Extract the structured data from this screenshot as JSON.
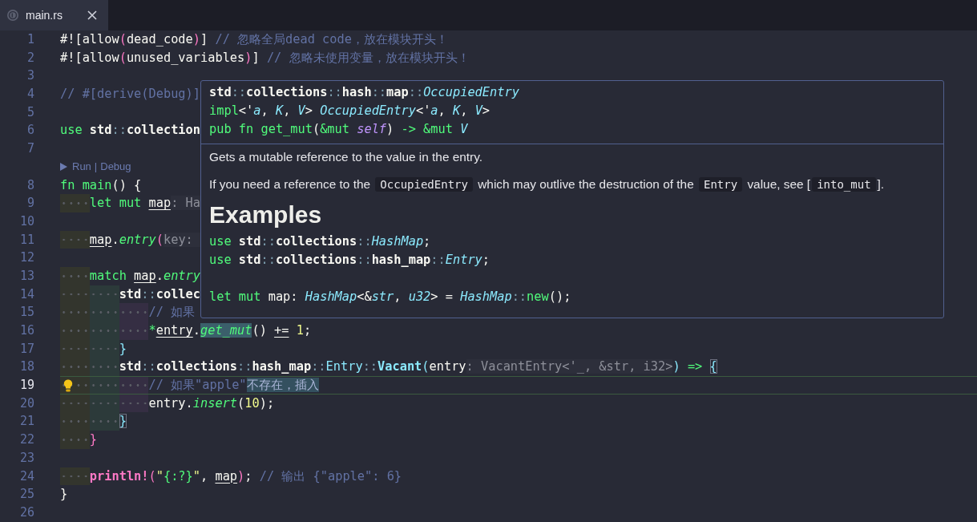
{
  "tab": {
    "label": "main.rs",
    "selected": true
  },
  "lines": [
    {
      "kind": "code",
      "number": "1",
      "current": false,
      "tokens": [
        {
          "text": "#![allow",
          "kind": "p"
        },
        {
          "text": "(",
          "kind": "paren"
        },
        {
          "text": "dead_code",
          "kind": "p"
        },
        {
          "text": ")",
          "kind": "paren"
        },
        {
          "text": "]",
          "kind": "p"
        },
        {
          "text": " // 忽略全局dead code，放在模块开头！",
          "kind": "cm"
        }
      ]
    },
    {
      "kind": "code",
      "number": "2",
      "current": false,
      "tokens": [
        {
          "text": "#![allow",
          "kind": "p"
        },
        {
          "text": "(",
          "kind": "paren"
        },
        {
          "text": "unused_variables",
          "kind": "p"
        },
        {
          "text": ")",
          "kind": "paren"
        },
        {
          "text": "]",
          "kind": "p"
        },
        {
          "text": " // 忽略未使用变量，放在模块开头！",
          "kind": "cm"
        }
      ]
    },
    {
      "kind": "code",
      "number": "3",
      "current": false
    },
    {
      "kind": "code",
      "number": "4",
      "current": false,
      "tokens": [
        {
          "text": "// #[derive(Debug)]",
          "kind": "cm"
        }
      ]
    },
    {
      "kind": "code",
      "number": "5",
      "current": false
    },
    {
      "kind": "code",
      "number": "6",
      "current": false,
      "tokens": [
        {
          "text": "use ",
          "kind": "kw"
        },
        {
          "text": "std",
          "kind": "path"
        },
        {
          "text": "::",
          "kind": "sep"
        },
        {
          "text": "collection",
          "kind": "path"
        }
      ]
    },
    {
      "kind": "code",
      "number": "7",
      "current": false
    },
    {
      "kind": "codelens",
      "run": "Run",
      "separator": "|",
      "debug": "Debug"
    },
    {
      "kind": "code",
      "number": "8",
      "current": false,
      "tokens": [
        {
          "text": "fn main",
          "kind": "kw"
        },
        {
          "text": "() {",
          "kind": "p"
        }
      ],
      "children": [
        {
          "kind": "code",
          "number": "9",
          "current": false,
          "tokens": [
            {
              "text": "let mut ",
              "kind": "kw"
            },
            {
              "text": "map",
              "kind": "mutvar"
            },
            {
              "text": ": Ha",
              "kind": "hint"
            }
          ]
        },
        {
          "kind": "code",
          "number": "10",
          "current": false
        },
        {
          "kind": "code",
          "number": "11",
          "current": false,
          "tokens": [
            {
              "text": "map",
              "kind": "mutvar"
            },
            {
              "text": ".",
              "kind": "p"
            },
            {
              "text": "entry",
              "kind": "fn"
            },
            {
              "text": "(",
              "kind": "paren"
            },
            {
              "text": "key: ",
              "kind": "hint"
            }
          ]
        },
        {
          "kind": "code",
          "number": "12",
          "current": false
        },
        {
          "kind": "code",
          "number": "13",
          "current": false,
          "tokens": [
            {
              "text": "match ",
              "kind": "kw"
            },
            {
              "text": "map",
              "kind": "mutvar"
            },
            {
              "text": ".",
              "kind": "p"
            },
            {
              "text": "entry",
              "kind": "fn"
            }
          ],
          "children": [
            {
              "kind": "code",
              "number": "14",
              "current": false,
              "tokens": [
                {
                  "text": "std",
                  "kind": "path"
                },
                {
                  "text": "::",
                  "kind": "sep"
                },
                {
                  "text": "collec",
                  "kind": "path"
                }
              ],
              "children": [
                {
                  "kind": "code",
                  "number": "15",
                  "current": false,
                  "tokens": [
                    {
                      "text": "// 如果",
                      "kind": "cm"
                    }
                  ]
                },
                {
                  "kind": "code",
                  "number": "16",
                  "current": false,
                  "tokens": [
                    {
                      "text": "*",
                      "kind": "kw"
                    },
                    {
                      "text": "entry",
                      "kind": "mutvar"
                    },
                    {
                      "text": ".",
                      "kind": "p"
                    },
                    {
                      "text": "get_mut",
                      "kind": "fnsel"
                    },
                    {
                      "text": "() ",
                      "kind": "p"
                    },
                    {
                      "text": "+=",
                      "kind": "opmut"
                    },
                    {
                      "text": " 1",
                      "kind": "num"
                    },
                    {
                      "text": ";",
                      "kind": "p"
                    }
                  ]
                }
              ]
            },
            {
              "kind": "code",
              "number": "17",
              "current": false,
              "tokens": [
                {
                  "text": "}",
                  "kind": "bracket2"
                }
              ]
            },
            {
              "kind": "code",
              "number": "18",
              "current": false,
              "tokens": [
                {
                  "text": "std",
                  "kind": "path"
                },
                {
                  "text": "::",
                  "kind": "sep"
                },
                {
                  "text": "collections",
                  "kind": "path"
                },
                {
                  "text": "::",
                  "kind": "sep"
                },
                {
                  "text": "hash_map",
                  "kind": "path"
                },
                {
                  "text": "::",
                  "kind": "sep"
                },
                {
                  "text": "Entry",
                  "kind": "ent"
                },
                {
                  "text": "::",
                  "kind": "sep"
                },
                {
                  "text": "Vacant",
                  "kind": "typeb"
                },
                {
                  "text": "(",
                  "kind": "bracket2"
                },
                {
                  "text": "entry",
                  "kind": "p"
                },
                {
                  "text": ": VacantEntry<'_, &str, i32>",
                  "kind": "hint"
                },
                {
                  "text": ") ",
                  "kind": "bracket2"
                },
                {
                  "text": "=> ",
                  "kind": "kw"
                },
                {
                  "text": "{",
                  "kind": "bracketmatch"
                }
              ],
              "children": [
                {
                  "kind": "code",
                  "number": "19",
                  "current": true,
                  "tokens": [
                    {
                      "text": "// 如果\"apple\"",
                      "kind": "cm"
                    },
                    {
                      "text": "不存在，插入",
                      "kind": "cmsel"
                    }
                  ]
                },
                {
                  "kind": "code",
                  "number": "20",
                  "current": false,
                  "tokens": [
                    {
                      "text": "entry",
                      "kind": "p"
                    },
                    {
                      "text": ".",
                      "kind": "p"
                    },
                    {
                      "text": "insert",
                      "kind": "fn"
                    },
                    {
                      "text": "(",
                      "kind": "p"
                    },
                    {
                      "text": "10",
                      "kind": "num"
                    },
                    {
                      "text": ");",
                      "kind": "p"
                    }
                  ]
                }
              ]
            },
            {
              "kind": "code",
              "number": "21",
              "current": false,
              "tokens": [
                {
                  "text": "}",
                  "kind": "bracketmatch"
                }
              ]
            }
          ]
        },
        {
          "kind": "code",
          "number": "22",
          "current": false,
          "tokens": [
            {
              "text": "}",
              "kind": "paren"
            }
          ]
        },
        {
          "kind": "code",
          "number": "23",
          "current": false
        },
        {
          "kind": "code",
          "number": "24",
          "current": false,
          "tokens": [
            {
              "text": "println!",
              "kind": "macro"
            },
            {
              "text": "(",
              "kind": "paren"
            },
            {
              "text": "\"",
              "kind": "str"
            },
            {
              "text": "{:?}",
              "kind": "fmt"
            },
            {
              "text": "\"",
              "kind": "str"
            },
            {
              "text": ", ",
              "kind": "p"
            },
            {
              "text": "map",
              "kind": "mutvar"
            },
            {
              "text": ")",
              "kind": "paren"
            },
            {
              "text": "; ",
              "kind": "p"
            },
            {
              "text": "// 输出 {\"apple\": 6}",
              "kind": "cm"
            }
          ]
        }
      ]
    },
    {
      "kind": "code",
      "number": "25",
      "current": false,
      "tokens": [
        {
          "text": "}",
          "kind": "p"
        }
      ]
    },
    {
      "kind": "code",
      "number": "26",
      "current": false
    }
  ],
  "hover": {
    "signature": [
      [
        {
          "text": "std",
          "kind": "path"
        },
        {
          "text": "::",
          "kind": "sep"
        },
        {
          "text": "collections",
          "kind": "path"
        },
        {
          "text": "::",
          "kind": "sep"
        },
        {
          "text": "hash",
          "kind": "path"
        },
        {
          "text": "::",
          "kind": "sep"
        },
        {
          "text": "map",
          "kind": "path"
        },
        {
          "text": "::",
          "kind": "sep"
        },
        {
          "text": "OccupiedEntry",
          "kind": "type"
        }
      ],
      [
        {
          "text": "impl",
          "kind": "kw"
        },
        {
          "text": "<'",
          "kind": "p"
        },
        {
          "text": "a",
          "kind": "type"
        },
        {
          "text": ", ",
          "kind": "p"
        },
        {
          "text": "K",
          "kind": "type"
        },
        {
          "text": ", ",
          "kind": "p"
        },
        {
          "text": "V",
          "kind": "type"
        },
        {
          "text": "> ",
          "kind": "p"
        },
        {
          "text": "OccupiedEntry",
          "kind": "type"
        },
        {
          "text": "<'",
          "kind": "p"
        },
        {
          "text": "a",
          "kind": "type"
        },
        {
          "text": ", ",
          "kind": "p"
        },
        {
          "text": "K",
          "kind": "type"
        },
        {
          "text": ", ",
          "kind": "p"
        },
        {
          "text": "V",
          "kind": "type"
        },
        {
          "text": ">",
          "kind": "p"
        }
      ],
      [
        {
          "text": "pub fn get_mut",
          "kind": "kw"
        },
        {
          "text": "(",
          "kind": "p"
        },
        {
          "text": "&mut ",
          "kind": "kw"
        },
        {
          "text": "self",
          "kind": "self"
        },
        {
          "text": ") ",
          "kind": "p"
        },
        {
          "text": "-> &mut ",
          "kind": "kw"
        },
        {
          "text": "V",
          "kind": "type"
        }
      ]
    ],
    "paragraphs": [
      [
        {
          "text": "Gets a mutable reference to the value in the entry."
        }
      ],
      [
        {
          "text": "If you need a reference to the "
        },
        {
          "code": "OccupiedEntry"
        },
        {
          "text": " which may outlive the destruction of the "
        },
        {
          "code": "Entry"
        },
        {
          "text": " value, see ["
        },
        {
          "code": "into_mut"
        },
        {
          "text": "]."
        }
      ]
    ],
    "heading": "Examples",
    "example": [
      {
        "blank_before": false,
        "tokens": [
          {
            "text": "use ",
            "kind": "kw"
          },
          {
            "text": "std",
            "kind": "path"
          },
          {
            "text": "::",
            "kind": "sep"
          },
          {
            "text": "collections",
            "kind": "path"
          },
          {
            "text": "::",
            "kind": "sep"
          },
          {
            "text": "HashMap",
            "kind": "type"
          },
          {
            "text": ";",
            "kind": "p"
          }
        ]
      },
      {
        "blank_before": false,
        "tokens": [
          {
            "text": "use ",
            "kind": "kw"
          },
          {
            "text": "std",
            "kind": "path"
          },
          {
            "text": "::",
            "kind": "sep"
          },
          {
            "text": "collections",
            "kind": "path"
          },
          {
            "text": "::",
            "kind": "sep"
          },
          {
            "text": "hash_map",
            "kind": "path"
          },
          {
            "text": "::",
            "kind": "sep"
          },
          {
            "text": "Entry",
            "kind": "type"
          },
          {
            "text": ";",
            "kind": "p"
          }
        ]
      },
      {
        "blank_before": true,
        "tokens": [
          {
            "text": "let mut ",
            "kind": "kw"
          },
          {
            "text": "map",
            "kind": "p"
          },
          {
            "text": ": ",
            "kind": "p"
          },
          {
            "text": "HashMap",
            "kind": "type"
          },
          {
            "text": "<&",
            "kind": "p"
          },
          {
            "text": "str",
            "kind": "type"
          },
          {
            "text": ", ",
            "kind": "p"
          },
          {
            "text": "u32",
            "kind": "type"
          },
          {
            "text": "> = ",
            "kind": "p"
          },
          {
            "text": "HashMap",
            "kind": "type"
          },
          {
            "text": "::",
            "kind": "sep"
          },
          {
            "text": "new",
            "kind": "kw"
          },
          {
            "text": "();",
            "kind": "p"
          }
        ]
      }
    ]
  }
}
